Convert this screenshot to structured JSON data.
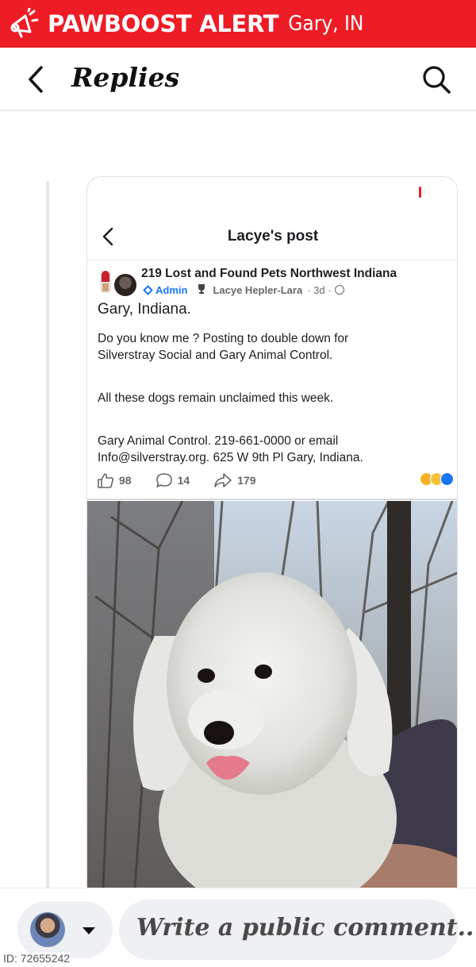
{
  "banner": {
    "brand": "PAWBOOST ALERT",
    "location": "Gary, IN",
    "icon": "megaphone-icon",
    "color": "#ee1c25"
  },
  "header": {
    "title": "Replies",
    "back_icon": "chevron-left-icon",
    "search_icon": "search-icon"
  },
  "post": {
    "nav_title": "Lacye's post",
    "group_name": "219 Lost and Found Pets Northwest Indiana",
    "admin_label": "Admin",
    "author": "Lacye Hepler-Lara",
    "time": "· 3d ·",
    "lines": [
      "Gary, Indiana.",
      "Do you know me ? Posting to double down for",
      "Silverstray Social and Gary Animal Control.",
      "All these dogs remain unclaimed this week.",
      "Gary Animal Control. 219-661-0000 or email",
      "Info@silverstray.org. 625 W 9th Pl Gary, Indiana."
    ],
    "reactions": {
      "likes": "98",
      "comments": "14",
      "shares": "179"
    }
  },
  "comment_bar": {
    "placeholder": "Write a public comment...",
    "id_label": "ID: 72655242"
  }
}
